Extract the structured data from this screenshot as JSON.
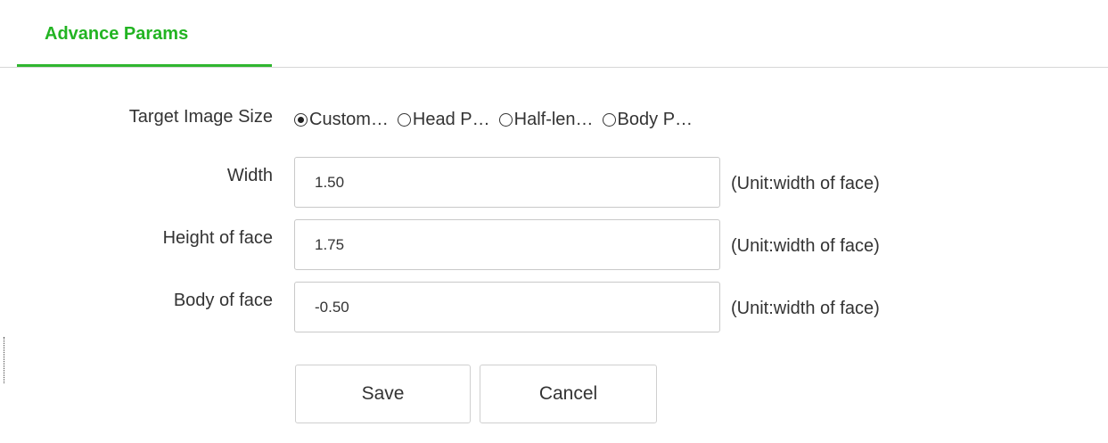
{
  "tabs": {
    "active_label": "Advance Params",
    "accent_color": "#22b422"
  },
  "form": {
    "target_size": {
      "label": "Target Image Size",
      "options": [
        {
          "label": "Custom…",
          "checked": true
        },
        {
          "label": "Head P…",
          "checked": false
        },
        {
          "label": "Half-len…",
          "checked": false
        },
        {
          "label": "Body P…",
          "checked": false
        }
      ]
    },
    "width": {
      "label": "Width",
      "value": "1.50",
      "unit": "(Unit:width of face)"
    },
    "height_of_face": {
      "label": "Height of face",
      "value": "1.75",
      "unit": "(Unit:width of face)"
    },
    "body_of_face": {
      "label": "Body of face",
      "value": "-0.50",
      "unit": "(Unit:width of face)"
    }
  },
  "actions": {
    "save_label": "Save",
    "cancel_label": "Cancel"
  }
}
